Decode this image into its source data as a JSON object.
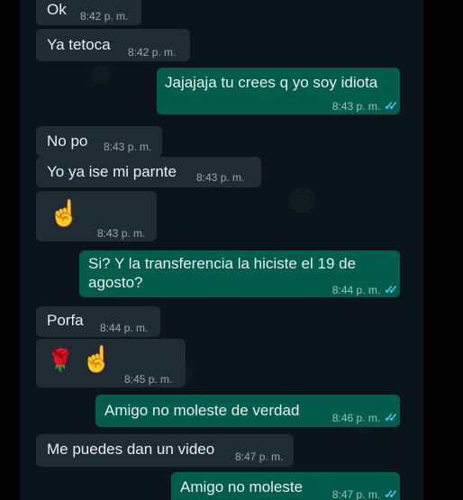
{
  "messages": [
    {
      "text": "Ok",
      "time": "8:42 p. m."
    },
    {
      "text": "Ya tetoca",
      "time": "8:42 p. m."
    },
    {
      "text": "Jajajaja tu crees q yo soy idiota",
      "time": "8:43 p. m."
    },
    {
      "text": "No po",
      "time": "8:43 p. m."
    },
    {
      "text": "Yo ya ise mi parnte",
      "time": "8:43 p. m."
    },
    {
      "emoji": "☝",
      "time": "8:43 p. m."
    },
    {
      "line1": "Si? Y la transferencia la hiciste el 19 de",
      "line2": "agosto?",
      "time": "8:44 p. m."
    },
    {
      "text": "Porfa",
      "time": "8:44 p. m."
    },
    {
      "emoji1": "🌹",
      "emoji2": "☝",
      "time": "8:45 p. m."
    },
    {
      "text": "Amigo no moleste de verdad",
      "time": "8:46 p. m."
    },
    {
      "text": "Me puedes dan un video",
      "time": "8:47 p. m."
    },
    {
      "text": "Amigo no moleste",
      "time": "8:47 p. m."
    }
  ],
  "read_tick_icon": "double-check-icon",
  "colors": {
    "background": "#0b141a",
    "incoming": "#1f2c34",
    "outgoing": "#005c4b",
    "tick": "#53bdeb"
  }
}
